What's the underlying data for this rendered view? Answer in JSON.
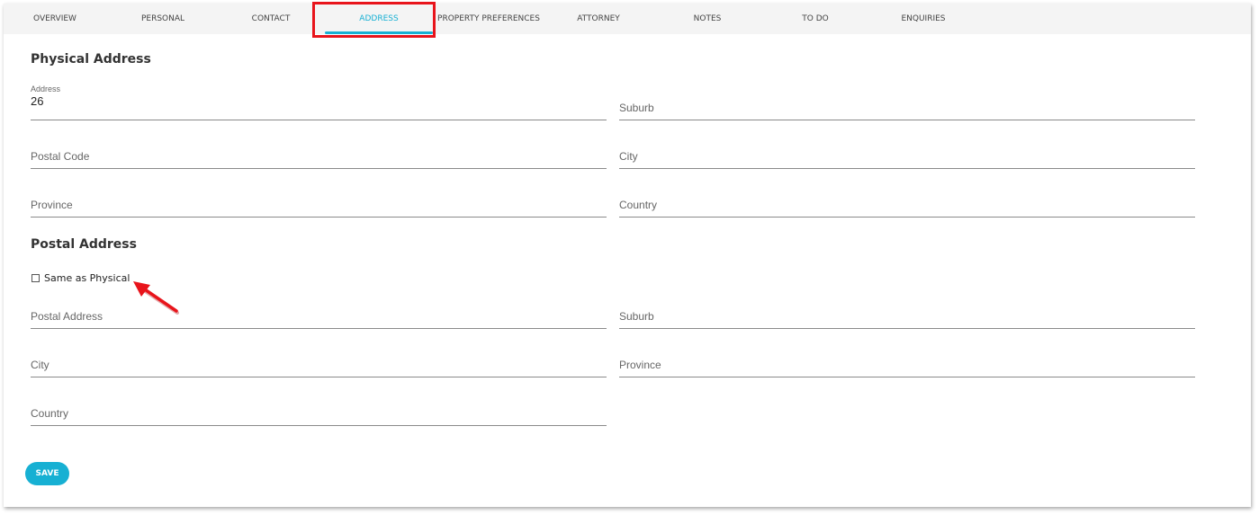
{
  "tabs": {
    "overview": "OVERVIEW",
    "personal": "PERSONAL",
    "contact": "CONTACT",
    "address": "ADDRESS",
    "property_preferences": "PROPERTY PREFERENCES",
    "attorney": "ATTORNEY",
    "notes": "NOTES",
    "todo": "TO DO",
    "enquiries": "ENQUIRIES",
    "active": "ADDRESS"
  },
  "physical": {
    "title": "Physical Address",
    "address_label": "Address",
    "address_value": "26",
    "suburb": "Suburb",
    "postal_code": "Postal Code",
    "city": "City",
    "province": "Province",
    "country": "Country"
  },
  "postal": {
    "title": "Postal Address",
    "same_as_physical": "Same as Physical",
    "same_as_physical_checked": false,
    "postal_address": "Postal Address",
    "suburb": "Suburb",
    "city": "City",
    "province": "Province",
    "country": "Country"
  },
  "actions": {
    "save": "SAVE"
  },
  "colors": {
    "accent": "#17b0d3",
    "annotation": "#e8141b"
  }
}
